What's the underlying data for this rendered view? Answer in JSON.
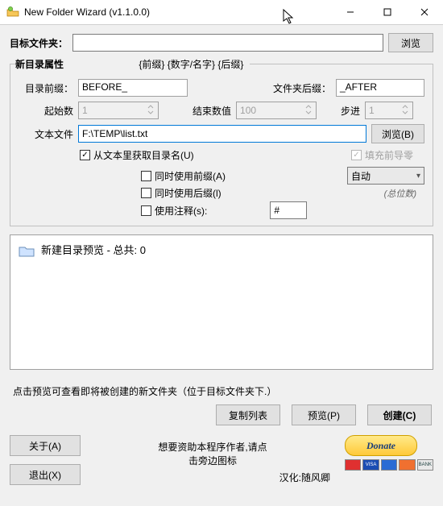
{
  "window": {
    "title": "New Folder Wizard  (v1.1.0.0)"
  },
  "target": {
    "label": "目标文件夹：",
    "value": "",
    "browse": "浏览"
  },
  "attr": {
    "legend": "新目录属性",
    "hint": "{前缀} {数字/名字} {后缀}",
    "prefix_label": "目录前缀：",
    "prefix_value": "BEFORE_",
    "suffix_label": "文件夹后缀：",
    "suffix_value": "_AFTER",
    "start_label": "起始数",
    "start_value": "1",
    "end_label": "结束数值",
    "end_value": "100",
    "step_label": "步进",
    "step_value": "1",
    "textfile_label": "文本文件",
    "textfile_value": "F:\\TEMP\\list.txt",
    "browse_b": "浏览(B)",
    "chk_fromtext": "从文本里获取目录名(U)",
    "chk_padzero": "填充前导零",
    "chk_useprefix": "同时使用前缀(A)",
    "chk_usesuffix": "同时使用后缀(l)",
    "chk_usecomment": "使用注释(s):",
    "comment_value": "#",
    "auto_label": "自动",
    "digits_label": "(总位数)"
  },
  "preview": {
    "title": "新建目录预览 - 总共: 0",
    "hint": "点击预览可查看即将被创建的新文件夹（位于目标文件夹下.）"
  },
  "buttons": {
    "copylist": "复制列表",
    "preview": "预览(P)",
    "create": "创建(C)",
    "about": "关于(A)",
    "exit": "退出(X)"
  },
  "footer": {
    "line1": "想要资助本程序作者,请点",
    "line2": "击旁边图标",
    "credit": "汉化:随风卿",
    "donate": "Donate"
  }
}
